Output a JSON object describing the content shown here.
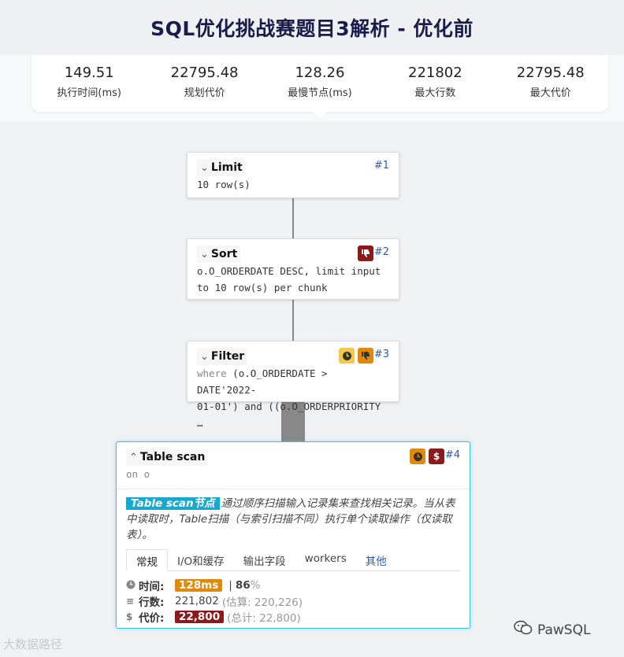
{
  "title": "SQL优化挑战赛题目3解析 - 优化前",
  "stats": [
    {
      "value": "149.51",
      "label": "执行时间(ms)"
    },
    {
      "value": "22795.48",
      "label": "规划代价"
    },
    {
      "value": "128.26",
      "label": "最慢节点(ms)"
    },
    {
      "value": "221802",
      "label": "最大行数"
    },
    {
      "value": "22795.48",
      "label": "最大代价"
    }
  ],
  "nodes": {
    "limit": {
      "name": "Limit",
      "id": "#1",
      "detail": "10 row(s)"
    },
    "sort": {
      "name": "Sort",
      "id": "#2",
      "detail_line1": "o.O_ORDERDATE DESC, limit input",
      "detail_line2": "to 10 row(s) per chunk"
    },
    "filter": {
      "name": "Filter",
      "id": "#3",
      "kw": "where",
      "detail_line1_rest": " (o.O_ORDERDATE > DATE'2022-",
      "detail_line2": "01-01') and ((o.O_ORDERPRIORITY …"
    },
    "scan": {
      "name": "Table scan",
      "id": "#4",
      "detail": "on o",
      "desc_highlight": "Table scan节点",
      "desc_text": "通过顺序扫描输入记录集来查找相关记录。当从表中读取时，Table扫描（与索引扫描不同）执行单个读取操作（仅读取表）。",
      "tabs": [
        "常规",
        "I/O和缓存",
        "输出字段",
        "workers",
        "其他"
      ],
      "time_label": "时间:",
      "time_value": "128ms",
      "time_sep": "|",
      "time_pct": "86",
      "time_pct_unit": "%",
      "rows_label": "行数:",
      "rows_value": "221,802",
      "rows_est": "(估算: 220,226)",
      "cost_label": "代价:",
      "cost_value": "22,800",
      "cost_total": "(总计: 22,800)"
    }
  },
  "icons": {
    "chevron": "chevron-down-icon",
    "thumbs_down": "thumbs-down-icon",
    "clock": "clock-icon",
    "dollar": "dollar-icon"
  },
  "colors": {
    "accent_blue": "#2a5db0",
    "scan_border": "#3cc3e0",
    "badge_red": "#8b1a1a",
    "badge_orange": "#e08a0b",
    "badge_yellow": "#f2c94c",
    "highlight": "#17a8cf"
  },
  "watermarks": {
    "left": "大数据路径",
    "right": "PawSQL"
  }
}
